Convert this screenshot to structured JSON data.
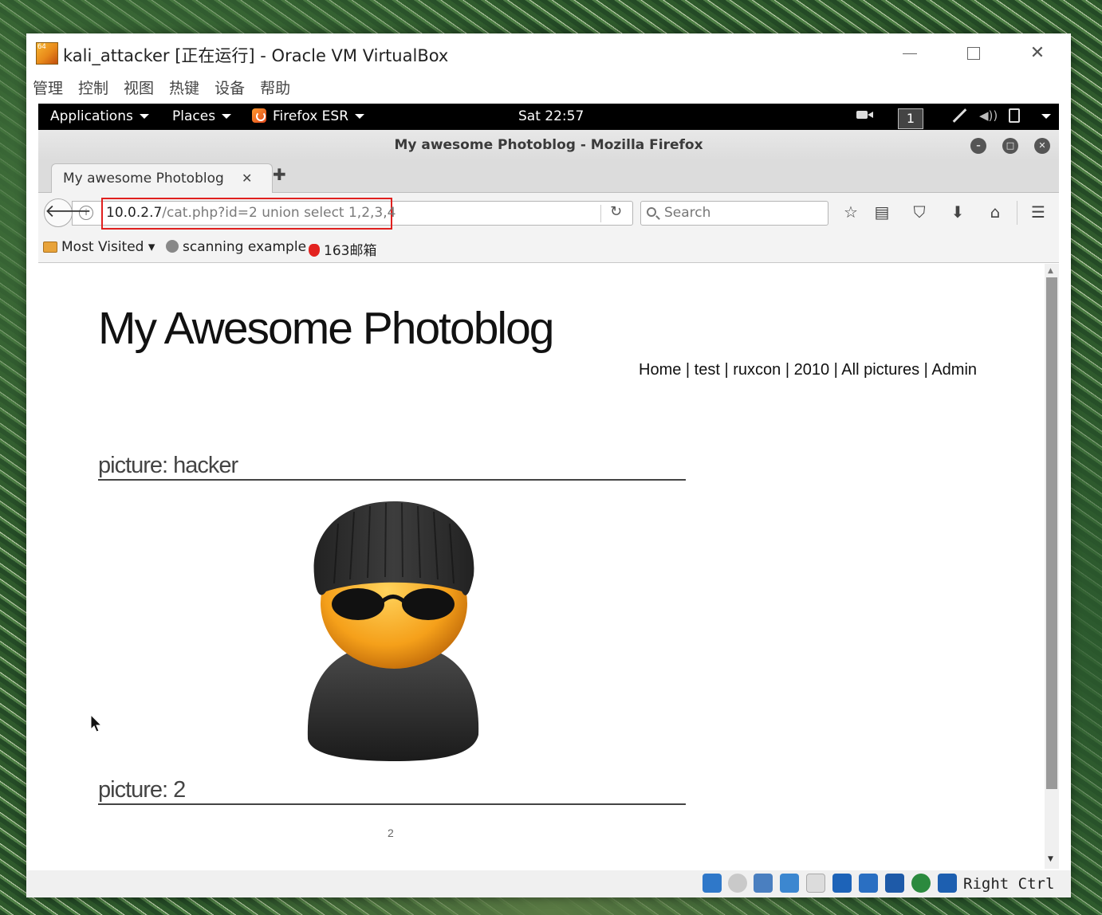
{
  "vbox": {
    "title": "kali_attacker [正在运行] - Oracle VM VirtualBox",
    "logo_badge": "64",
    "menu": [
      "管理",
      "控制",
      "视图",
      "热键",
      "设备",
      "帮助"
    ],
    "host_key": "Right Ctrl"
  },
  "gnome": {
    "applications": "Applications",
    "places": "Places",
    "firefox": "Firefox ESR",
    "clock": "Sat 22:57",
    "workspace": "1"
  },
  "firefox": {
    "window_title": "My awesome Photoblog - Mozilla Firefox",
    "tab_label": "My awesome Photoblog",
    "url_host": "10.0.2.7",
    "url_path": "/cat.php?id=2 union select 1,2,3,4",
    "search_placeholder": "Search",
    "bookmarks": {
      "most_visited": "Most Visited",
      "scanning": "scanning example",
      "mail163": "163邮箱"
    }
  },
  "page": {
    "site_title": "My Awesome Photoblog",
    "nav": [
      "Home",
      "test",
      "ruxcon",
      "2010",
      "All pictures",
      "Admin"
    ],
    "picture1_heading": "picture: hacker",
    "picture2_heading": "picture: 2",
    "picture2_caption": "2"
  },
  "colors": {
    "url_highlight": "#e0201e",
    "gnome_bar": "#000000",
    "firefox_chrome": "#f3f3f3"
  }
}
